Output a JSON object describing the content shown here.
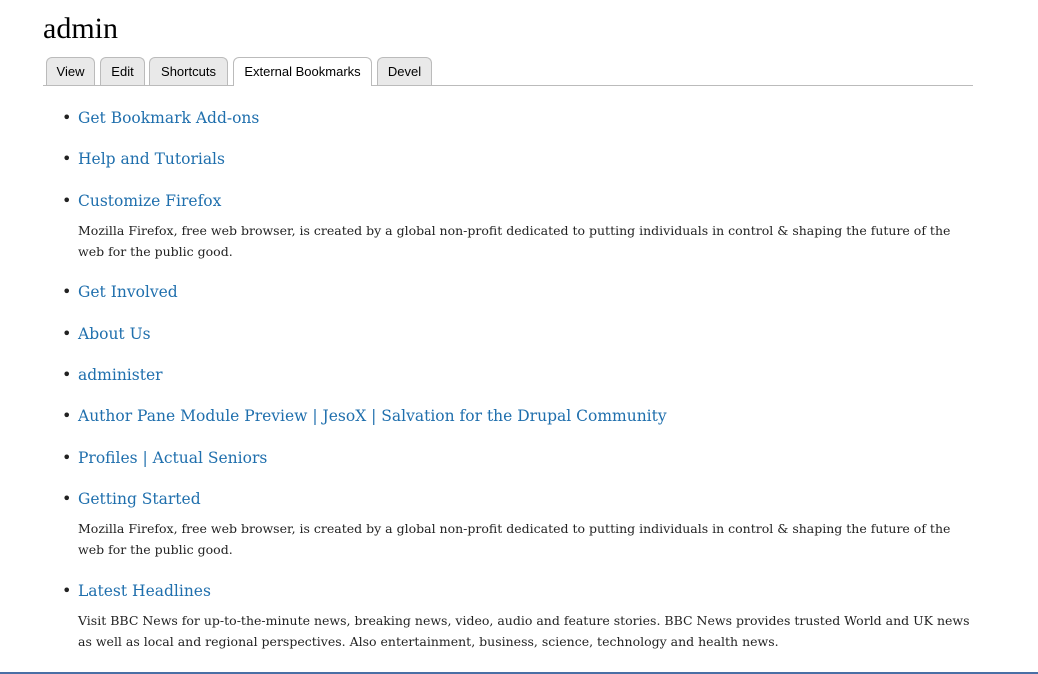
{
  "page": {
    "title": "admin"
  },
  "tabs": [
    {
      "label": "View",
      "active": false
    },
    {
      "label": "Edit",
      "active": false
    },
    {
      "label": "Shortcuts",
      "active": false
    },
    {
      "label": "External Bookmarks",
      "active": true
    },
    {
      "label": "Devel",
      "active": false
    }
  ],
  "bookmarks": [
    {
      "title": "Get Bookmark Add-ons",
      "description": ""
    },
    {
      "title": "Help and Tutorials",
      "description": ""
    },
    {
      "title": "Customize Firefox",
      "description": "Mozilla Firefox, free web browser, is created by a global non-profit dedicated to putting individuals in control & shaping the future of the web for the public good."
    },
    {
      "title": "Get Involved",
      "description": ""
    },
    {
      "title": "About Us",
      "description": ""
    },
    {
      "title": "administer",
      "description": ""
    },
    {
      "title": "Author Pane Module Preview | JesoX | Salvation for the Drupal Community",
      "description": ""
    },
    {
      "title": "Profiles | Actual Seniors",
      "description": ""
    },
    {
      "title": "Getting Started",
      "description": "Mozilla Firefox, free web browser, is created by a global non-profit dedicated to putting individuals in control & shaping the future of the web for the public good."
    },
    {
      "title": "Latest Headlines",
      "description": "Visit BBC News for up-to-the-minute news, breaking news, video, audio and feature stories. BBC News provides trusted World and UK news as well as local and regional perspectives. Also entertainment, business, science, technology and health news."
    }
  ],
  "colors": {
    "link": "#1f6fad",
    "text": "#222222",
    "tab_border": "#bbbbbb",
    "tab_bg": "#e9e9e9",
    "bottom_rule": "#4a6fa5"
  }
}
